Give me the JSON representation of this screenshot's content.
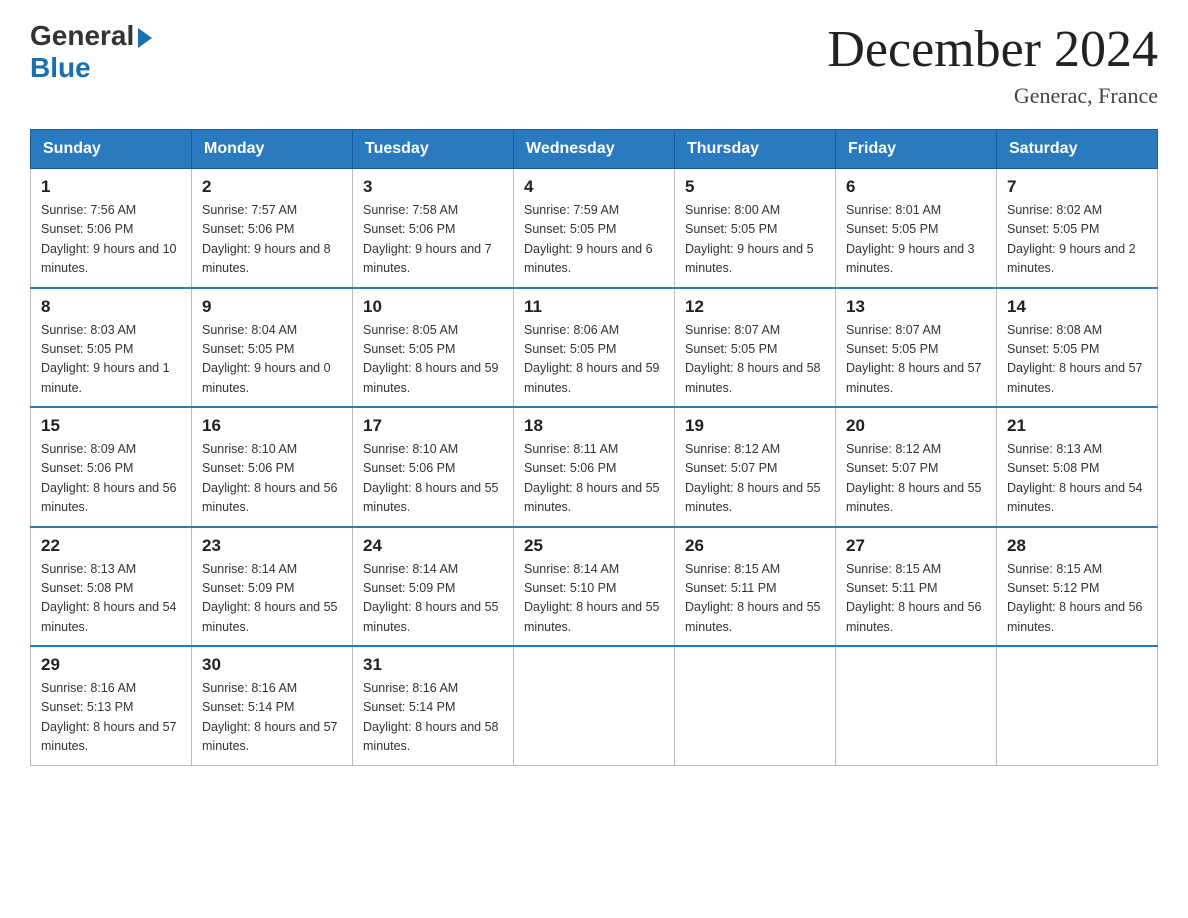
{
  "header": {
    "logo_general": "General",
    "logo_blue": "Blue",
    "title": "December 2024",
    "subtitle": "Generac, France"
  },
  "days_of_week": [
    "Sunday",
    "Monday",
    "Tuesday",
    "Wednesday",
    "Thursday",
    "Friday",
    "Saturday"
  ],
  "weeks": [
    [
      {
        "day": "1",
        "sunrise": "7:56 AM",
        "sunset": "5:06 PM",
        "daylight": "9 hours and 10 minutes."
      },
      {
        "day": "2",
        "sunrise": "7:57 AM",
        "sunset": "5:06 PM",
        "daylight": "9 hours and 8 minutes."
      },
      {
        "day": "3",
        "sunrise": "7:58 AM",
        "sunset": "5:06 PM",
        "daylight": "9 hours and 7 minutes."
      },
      {
        "day": "4",
        "sunrise": "7:59 AM",
        "sunset": "5:05 PM",
        "daylight": "9 hours and 6 minutes."
      },
      {
        "day": "5",
        "sunrise": "8:00 AM",
        "sunset": "5:05 PM",
        "daylight": "9 hours and 5 minutes."
      },
      {
        "day": "6",
        "sunrise": "8:01 AM",
        "sunset": "5:05 PM",
        "daylight": "9 hours and 3 minutes."
      },
      {
        "day": "7",
        "sunrise": "8:02 AM",
        "sunset": "5:05 PM",
        "daylight": "9 hours and 2 minutes."
      }
    ],
    [
      {
        "day": "8",
        "sunrise": "8:03 AM",
        "sunset": "5:05 PM",
        "daylight": "9 hours and 1 minute."
      },
      {
        "day": "9",
        "sunrise": "8:04 AM",
        "sunset": "5:05 PM",
        "daylight": "9 hours and 0 minutes."
      },
      {
        "day": "10",
        "sunrise": "8:05 AM",
        "sunset": "5:05 PM",
        "daylight": "8 hours and 59 minutes."
      },
      {
        "day": "11",
        "sunrise": "8:06 AM",
        "sunset": "5:05 PM",
        "daylight": "8 hours and 59 minutes."
      },
      {
        "day": "12",
        "sunrise": "8:07 AM",
        "sunset": "5:05 PM",
        "daylight": "8 hours and 58 minutes."
      },
      {
        "day": "13",
        "sunrise": "8:07 AM",
        "sunset": "5:05 PM",
        "daylight": "8 hours and 57 minutes."
      },
      {
        "day": "14",
        "sunrise": "8:08 AM",
        "sunset": "5:05 PM",
        "daylight": "8 hours and 57 minutes."
      }
    ],
    [
      {
        "day": "15",
        "sunrise": "8:09 AM",
        "sunset": "5:06 PM",
        "daylight": "8 hours and 56 minutes."
      },
      {
        "day": "16",
        "sunrise": "8:10 AM",
        "sunset": "5:06 PM",
        "daylight": "8 hours and 56 minutes."
      },
      {
        "day": "17",
        "sunrise": "8:10 AM",
        "sunset": "5:06 PM",
        "daylight": "8 hours and 55 minutes."
      },
      {
        "day": "18",
        "sunrise": "8:11 AM",
        "sunset": "5:06 PM",
        "daylight": "8 hours and 55 minutes."
      },
      {
        "day": "19",
        "sunrise": "8:12 AM",
        "sunset": "5:07 PM",
        "daylight": "8 hours and 55 minutes."
      },
      {
        "day": "20",
        "sunrise": "8:12 AM",
        "sunset": "5:07 PM",
        "daylight": "8 hours and 55 minutes."
      },
      {
        "day": "21",
        "sunrise": "8:13 AM",
        "sunset": "5:08 PM",
        "daylight": "8 hours and 54 minutes."
      }
    ],
    [
      {
        "day": "22",
        "sunrise": "8:13 AM",
        "sunset": "5:08 PM",
        "daylight": "8 hours and 54 minutes."
      },
      {
        "day": "23",
        "sunrise": "8:14 AM",
        "sunset": "5:09 PM",
        "daylight": "8 hours and 55 minutes."
      },
      {
        "day": "24",
        "sunrise": "8:14 AM",
        "sunset": "5:09 PM",
        "daylight": "8 hours and 55 minutes."
      },
      {
        "day": "25",
        "sunrise": "8:14 AM",
        "sunset": "5:10 PM",
        "daylight": "8 hours and 55 minutes."
      },
      {
        "day": "26",
        "sunrise": "8:15 AM",
        "sunset": "5:11 PM",
        "daylight": "8 hours and 55 minutes."
      },
      {
        "day": "27",
        "sunrise": "8:15 AM",
        "sunset": "5:11 PM",
        "daylight": "8 hours and 56 minutes."
      },
      {
        "day": "28",
        "sunrise": "8:15 AM",
        "sunset": "5:12 PM",
        "daylight": "8 hours and 56 minutes."
      }
    ],
    [
      {
        "day": "29",
        "sunrise": "8:16 AM",
        "sunset": "5:13 PM",
        "daylight": "8 hours and 57 minutes."
      },
      {
        "day": "30",
        "sunrise": "8:16 AM",
        "sunset": "5:14 PM",
        "daylight": "8 hours and 57 minutes."
      },
      {
        "day": "31",
        "sunrise": "8:16 AM",
        "sunset": "5:14 PM",
        "daylight": "8 hours and 58 minutes."
      },
      null,
      null,
      null,
      null
    ]
  ]
}
